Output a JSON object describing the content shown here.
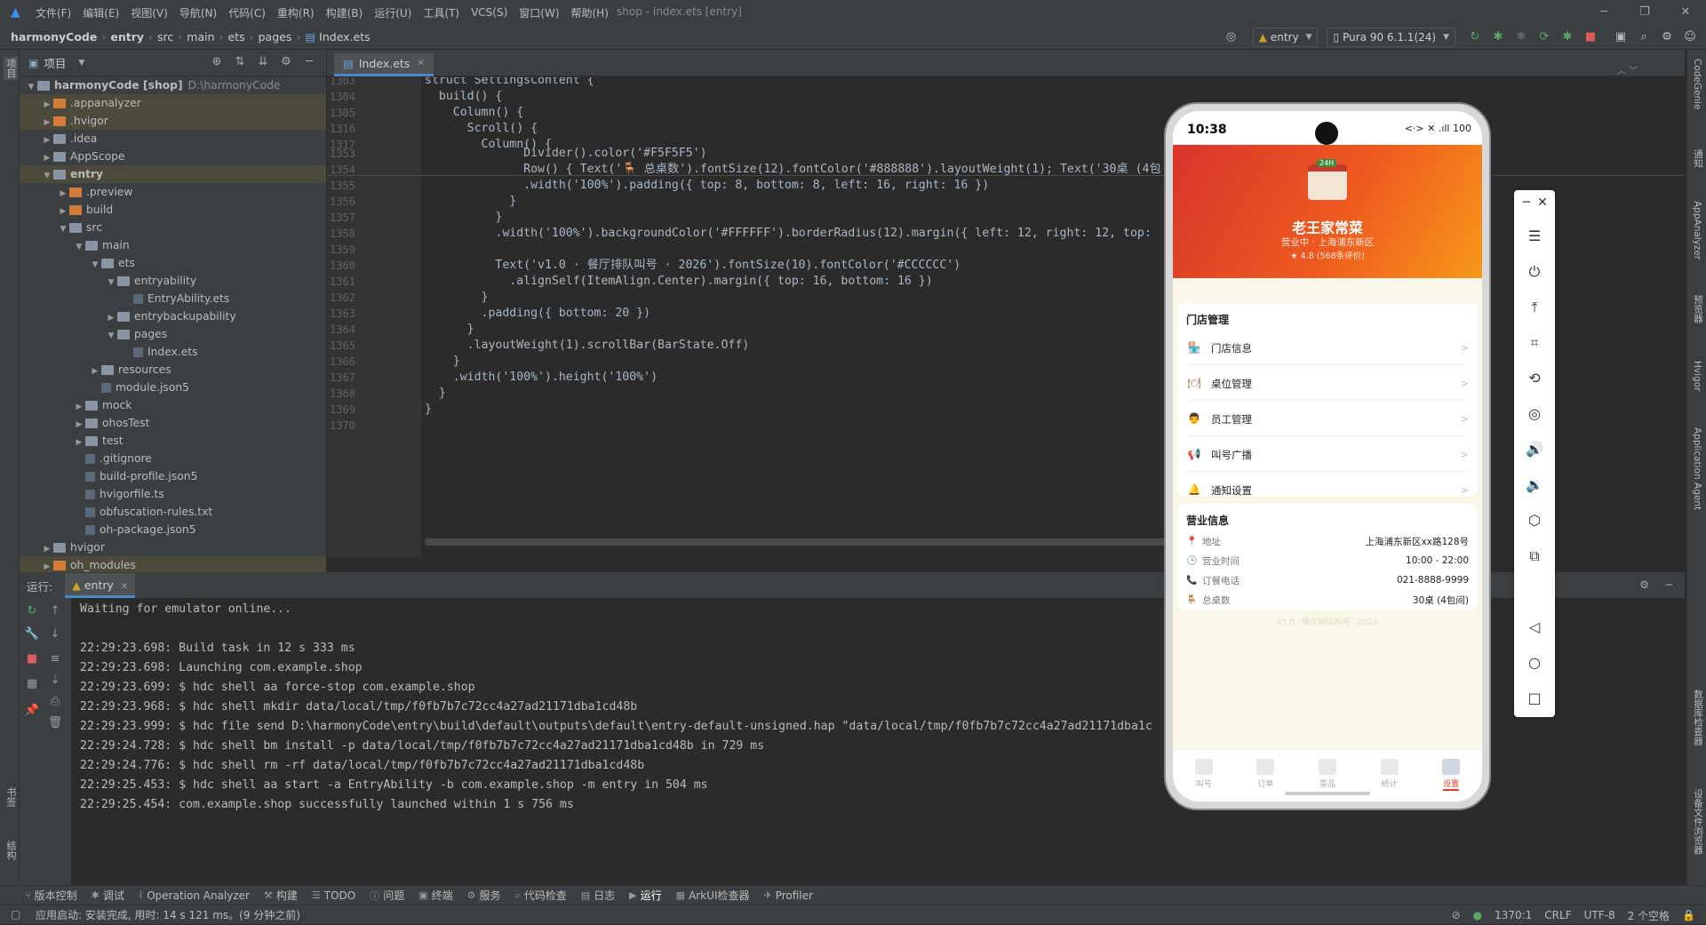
{
  "window": {
    "title": "shop - Index.ets [entry]",
    "menu": [
      "文件(F)",
      "编辑(E)",
      "视图(V)",
      "导航(N)",
      "代码(C)",
      "重构(R)",
      "构建(B)",
      "运行(U)",
      "工具(T)",
      "VCS(S)",
      "窗口(W)",
      "帮助(H)"
    ]
  },
  "breadcrumb": [
    "harmonyCode",
    "entry",
    "src",
    "main",
    "ets",
    "pages",
    "Index.ets"
  ],
  "toolbar": {
    "run_config": "entry",
    "device": "Pura 90 6.1.1(24)"
  },
  "left_strip": {
    "project": "项目",
    "bookmarks": "书签",
    "structure": "结构"
  },
  "right_strip": [
    "CodeGenie",
    "通知",
    "AppAnalyzer",
    "预览器",
    "Hvigor",
    "Application Agent",
    "数据库检查器",
    "设备文件浏览器"
  ],
  "project_panel": {
    "title": "项目",
    "tree": [
      {
        "label": "harmonyCode [shop]",
        "dim": "D:\\harmonyCode",
        "depth": 0,
        "open": true,
        "kind": "folder"
      },
      {
        "label": ".appanalyzer",
        "depth": 1,
        "open": false,
        "kind": "folderx"
      },
      {
        "label": ".hvigor",
        "depth": 1,
        "open": false,
        "kind": "folderx"
      },
      {
        "label": ".idea",
        "depth": 1,
        "open": false,
        "kind": "folder"
      },
      {
        "label": "AppScope",
        "depth": 1,
        "open": false,
        "kind": "folder"
      },
      {
        "label": "entry",
        "depth": 1,
        "open": true,
        "kind": "folder"
      },
      {
        "label": ".preview",
        "depth": 2,
        "open": false,
        "kind": "folderx"
      },
      {
        "label": "build",
        "depth": 2,
        "open": false,
        "kind": "folderx"
      },
      {
        "label": "src",
        "depth": 2,
        "open": true,
        "kind": "folder"
      },
      {
        "label": "main",
        "depth": 3,
        "open": true,
        "kind": "folder"
      },
      {
        "label": "ets",
        "depth": 4,
        "open": true,
        "kind": "folder"
      },
      {
        "label": "entryability",
        "depth": 5,
        "open": true,
        "kind": "folder"
      },
      {
        "label": "EntryAbility.ets",
        "depth": 6,
        "kind": "file"
      },
      {
        "label": "entrybackupability",
        "depth": 5,
        "open": false,
        "kind": "folder"
      },
      {
        "label": "pages",
        "depth": 5,
        "open": true,
        "kind": "folder"
      },
      {
        "label": "Index.ets",
        "depth": 6,
        "kind": "file"
      },
      {
        "label": "resources",
        "depth": 4,
        "open": false,
        "kind": "folder"
      },
      {
        "label": "module.json5",
        "depth": 4,
        "kind": "file"
      },
      {
        "label": "mock",
        "depth": 3,
        "open": false,
        "kind": "folder"
      },
      {
        "label": "ohosTest",
        "depth": 3,
        "open": false,
        "kind": "folder"
      },
      {
        "label": "test",
        "depth": 3,
        "open": false,
        "kind": "folder"
      },
      {
        "label": ".gitignore",
        "depth": 3,
        "kind": "file"
      },
      {
        "label": "build-profile.json5",
        "depth": 3,
        "kind": "file"
      },
      {
        "label": "hvigorfile.ts",
        "depth": 3,
        "kind": "file"
      },
      {
        "label": "obfuscation-rules.txt",
        "depth": 3,
        "kind": "file"
      },
      {
        "label": "oh-package.json5",
        "depth": 3,
        "kind": "file"
      },
      {
        "label": "hvigor",
        "depth": 1,
        "open": false,
        "kind": "folder"
      },
      {
        "label": "oh_modules",
        "depth": 1,
        "open": false,
        "kind": "folderx"
      }
    ]
  },
  "editor": {
    "tab": "Index.ets",
    "warnings": "⚠4",
    "sticky": [
      {
        "n": "1303",
        "t": "struct SettingsContent {"
      },
      {
        "n": "1304",
        "t": "  build() {"
      },
      {
        "n": "1305",
        "t": "    Column() {"
      },
      {
        "n": "1316",
        "t": "      Scroll() {"
      },
      {
        "n": "1317",
        "t": "        Column() {"
      }
    ],
    "lines": [
      {
        "n": "1353",
        "t": "              Divider().color('#F5F5F5')"
      },
      {
        "n": "1354",
        "t": "              Row() { Text('🪑 总桌数').fontSize(12).fontColor('#888888').layoutWeight(1); Text('30桌 (4包"
      },
      {
        "n": "1355",
        "t": "              .width('100%').padding({ top: 8, bottom: 8, left: 16, right: 16 })"
      },
      {
        "n": "1356",
        "t": "            }"
      },
      {
        "n": "1357",
        "t": "          }"
      },
      {
        "n": "1358",
        "t": "          .width('100%').backgroundColor('#FFFFFF').borderRadius(12).margin({ left: 12, right: 12, top:"
      },
      {
        "n": "1359",
        "t": ""
      },
      {
        "n": "1360",
        "t": "          Text('v1.0 · 餐厅排队叫号 · 2026').fontSize(10).fontColor('#CCCCCC')"
      },
      {
        "n": "1361",
        "t": "            .alignSelf(ItemAlign.Center).margin({ top: 16, bottom: 16 })"
      },
      {
        "n": "1362",
        "t": "        }"
      },
      {
        "n": "1363",
        "t": "        .padding({ bottom: 20 })"
      },
      {
        "n": "1364",
        "t": "      }"
      },
      {
        "n": "1365",
        "t": "      .layoutWeight(1).scrollBar(BarState.Off)"
      },
      {
        "n": "1366",
        "t": "    }"
      },
      {
        "n": "1367",
        "t": "    .width('100%').height('100%')"
      },
      {
        "n": "1368",
        "t": "  }"
      },
      {
        "n": "1369",
        "t": "}"
      },
      {
        "n": "1370",
        "t": ""
      }
    ]
  },
  "run_panel": {
    "label": "运行:",
    "tab": "entry",
    "log": [
      "Waiting for emulator online...",
      "",
      "22:29:23.698: Build task in 12 s 333 ms",
      "22:29:23.698: Launching com.example.shop",
      "22:29:23.699: $ hdc shell aa force-stop com.example.shop",
      "22:29:23.968: $ hdc shell mkdir data/local/tmp/f0fb7b7c72cc4a27ad21171dba1cd48b",
      "22:29:23.999: $ hdc file send D:\\harmonyCode\\entry\\build\\default\\outputs\\default\\entry-default-unsigned.hap \"data/local/tmp/f0fb7b7c72cc4a27ad21171dba1c",
      "22:29:24.728: $ hdc shell bm install -p data/local/tmp/f0fb7b7c72cc4a27ad21171dba1cd48b in 729 ms",
      "22:29:24.776: $ hdc shell rm -rf data/local/tmp/f0fb7b7c72cc4a27ad21171dba1cd48b",
      "22:29:25.453: $ hdc shell aa start -a EntryAbility -b com.example.shop -m entry in 504 ms",
      "22:29:25.454: com.example.shop successfully launched within 1 s 756 ms"
    ]
  },
  "bottom_tabs": [
    "版本控制",
    "调试",
    "Operation Analyzer",
    "构建",
    "TODO",
    "问题",
    "终端",
    "服务",
    "代码检查",
    "日志",
    "运行",
    "ArkUI检查器",
    "Profiler"
  ],
  "status": {
    "message": "应用启动: 安装完成, 用时: 14 s 121 ms。(9 分钟之前)",
    "position": "1370:1",
    "line_ending": "CRLF",
    "encoding": "UTF-8",
    "indent": "2 个空格"
  },
  "phone": {
    "time": "10:38",
    "signal": "<·> ✕ .ıll 100",
    "shop_name": "老王家常菜",
    "shop_badge": "24H",
    "shop_sub": "营业中 · 上海浦东新区",
    "rating": "★ 4.8 (568条评价)",
    "store_title": "门店管理",
    "menu": [
      {
        "label": "门店信息",
        "icon": "store-icon"
      },
      {
        "label": "桌位管理",
        "icon": "table-icon"
      },
      {
        "label": "员工管理",
        "icon": "staff-icon"
      },
      {
        "label": "叫号广播",
        "icon": "broadcast-icon"
      },
      {
        "label": "通知设置",
        "icon": "bell-icon"
      }
    ],
    "info_title": "营业信息",
    "info": [
      {
        "k": "地址",
        "v": "上海浦东新区xx路128号"
      },
      {
        "k": "营业时间",
        "v": "10:00 - 22:00"
      },
      {
        "k": "订餐电话",
        "v": "021-8888-9999"
      },
      {
        "k": "总桌数",
        "v": "30桌 (4包间)"
      }
    ],
    "version": "v1.0 · 餐厅排队叫号 · 2026",
    "tabs": [
      "叫号",
      "订单",
      "菜品",
      "统计",
      "设置"
    ],
    "active_tab": 4
  }
}
